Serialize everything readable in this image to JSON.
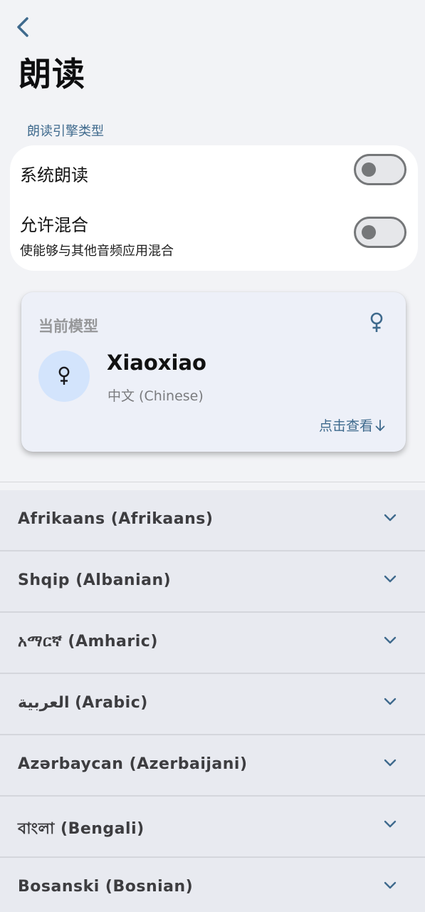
{
  "header": {
    "title": "朗读"
  },
  "engine_section": {
    "label": "朗读引擎类型",
    "settings": [
      {
        "title": "系统朗读",
        "subtitle": "",
        "enabled": false
      },
      {
        "title": "允许混合",
        "subtitle": "使能够与其他音频应用混合",
        "enabled": false
      }
    ]
  },
  "current_model": {
    "label": "当前模型",
    "voice_name": "Xiaoxiao",
    "language": "中文 (Chinese)",
    "gender_icon": "female-icon",
    "view_link": "点击查看"
  },
  "languages": [
    {
      "label": "Afrikaans (Afrikaans)"
    },
    {
      "label": "Shqip (Albanian)"
    },
    {
      "label": "አማርኛ (Amharic)"
    },
    {
      "label": "العربية (Arabic)"
    },
    {
      "label": "Azərbaycan (Azerbaijani)"
    },
    {
      "label": "বাংলা (Bengali)"
    },
    {
      "label": "Bosanski (Bosnian)"
    }
  ],
  "colors": {
    "accent": "#3f6a8d",
    "background": "#f2f3f6",
    "list_item": "#e8eaf0",
    "avatar_bg": "#d3e4fc"
  }
}
